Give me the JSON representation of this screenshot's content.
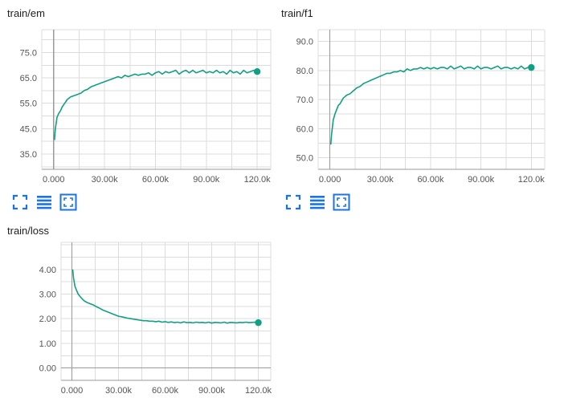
{
  "colors": {
    "series": "#12a083",
    "icon": "#1a73e8",
    "grid": "#dcdcdc"
  },
  "toolbar_icons": [
    "fit-domain-icon",
    "toggle-log-scale-icon",
    "expand-chart-icon"
  ],
  "chart_data": [
    {
      "id": "train-em",
      "type": "line",
      "title": "train/em",
      "xlabel": "",
      "ylabel": "",
      "x_ticks": [
        0,
        30000,
        60000,
        90000,
        120000
      ],
      "x_tick_labels": [
        "0.000",
        "30.00k",
        "60.00k",
        "90.00k",
        "120.0k"
      ],
      "y_ticks": [
        35,
        45,
        55,
        65,
        75
      ],
      "y_tick_labels": [
        "35.0",
        "45.0",
        "55.0",
        "65.0",
        "75.0"
      ],
      "xlim": [
        -7000,
        128000
      ],
      "ylim": [
        29,
        84
      ],
      "grid": true,
      "legend": "none",
      "series": [
        {
          "x": [
            500,
            1000,
            2000,
            3000,
            4000,
            5000,
            6000,
            7000,
            8000,
            10000,
            12000,
            14000,
            16000,
            18000,
            20000,
            22000,
            24000,
            26000,
            28000,
            30000,
            32000,
            34000,
            36000,
            38000,
            40000,
            42000,
            44000,
            46000,
            48000,
            50000,
            52000,
            54000,
            56000,
            58000,
            60000,
            62000,
            64000,
            66000,
            68000,
            70000,
            72000,
            74000,
            76000,
            78000,
            80000,
            82000,
            84000,
            86000,
            88000,
            90000,
            92000,
            94000,
            96000,
            98000,
            100000,
            102000,
            104000,
            106000,
            108000,
            110000,
            112000,
            114000,
            116000,
            118000,
            120000
          ],
          "y": [
            40.5,
            45,
            49.5,
            51,
            52,
            53.5,
            54.5,
            55.5,
            56.5,
            57.5,
            58,
            58.5,
            59,
            60,
            60.5,
            61.5,
            62,
            62.5,
            63,
            63.5,
            64,
            64.5,
            65,
            65.5,
            65,
            66,
            65.5,
            66,
            66.5,
            66,
            66.5,
            66.5,
            67,
            66,
            67,
            67.5,
            66.5,
            67.5,
            67,
            67.5,
            68,
            66.5,
            67.5,
            68,
            67,
            68,
            67,
            67.5,
            68,
            67,
            67.5,
            67,
            68,
            67,
            67.5,
            66.5,
            68,
            67,
            67.5,
            66.5,
            68,
            67,
            67.5,
            68,
            67.5
          ]
        }
      ]
    },
    {
      "id": "train-f1",
      "type": "line",
      "title": "train/f1",
      "xlabel": "",
      "ylabel": "",
      "x_ticks": [
        0,
        30000,
        60000,
        90000,
        120000
      ],
      "x_tick_labels": [
        "0.000",
        "30.00k",
        "60.00k",
        "90.00k",
        "120.0k"
      ],
      "y_ticks": [
        50,
        60,
        70,
        80,
        90
      ],
      "y_tick_labels": [
        "50.0",
        "60.0",
        "70.0",
        "80.0",
        "90.0"
      ],
      "xlim": [
        -7000,
        128000
      ],
      "ylim": [
        46,
        94
      ],
      "grid": true,
      "legend": "none",
      "series": [
        {
          "x": [
            500,
            1000,
            2000,
            3000,
            4000,
            5000,
            6000,
            7000,
            8000,
            10000,
            12000,
            14000,
            16000,
            18000,
            20000,
            22000,
            24000,
            26000,
            28000,
            30000,
            32000,
            34000,
            36000,
            38000,
            40000,
            42000,
            44000,
            46000,
            48000,
            50000,
            52000,
            54000,
            56000,
            58000,
            60000,
            62000,
            64000,
            66000,
            68000,
            70000,
            72000,
            74000,
            76000,
            78000,
            80000,
            82000,
            84000,
            86000,
            88000,
            90000,
            92000,
            94000,
            96000,
            98000,
            100000,
            102000,
            104000,
            106000,
            108000,
            110000,
            112000,
            114000,
            116000,
            118000,
            120000
          ],
          "y": [
            54.5,
            58,
            63,
            65,
            66.5,
            68,
            68.5,
            69.5,
            70.5,
            71.5,
            72,
            73,
            74,
            74.5,
            75.5,
            76,
            76.5,
            77,
            77.5,
            78,
            78.5,
            79,
            79,
            79.5,
            79.5,
            80,
            79.5,
            80.5,
            80,
            80.5,
            80.5,
            81,
            80.5,
            81,
            80.5,
            81,
            80.5,
            81,
            81,
            80.5,
            81.5,
            80.5,
            81,
            81.5,
            80.5,
            81,
            81,
            80.5,
            81.5,
            80.5,
            81,
            81,
            80.5,
            81,
            81.5,
            80.5,
            81,
            81,
            80.5,
            81,
            80.5,
            81.5,
            80.5,
            81,
            81
          ]
        }
      ]
    },
    {
      "id": "train-loss",
      "type": "line",
      "title": "train/loss",
      "xlabel": "",
      "ylabel": "",
      "x_ticks": [
        0,
        30000,
        60000,
        90000,
        120000
      ],
      "x_tick_labels": [
        "0.000",
        "30.00k",
        "60.00k",
        "90.00k",
        "120.0k"
      ],
      "y_ticks": [
        0,
        1,
        2,
        3,
        4
      ],
      "y_tick_labels": [
        "0.00",
        "1.00",
        "2.00",
        "3.00",
        "4.00"
      ],
      "xlim": [
        -7000,
        128000
      ],
      "ylim": [
        -0.5,
        5.1
      ],
      "grid": true,
      "legend": "none",
      "series": [
        {
          "x": [
            500,
            1000,
            2000,
            3000,
            4000,
            5000,
            6000,
            7000,
            8000,
            10000,
            12000,
            14000,
            16000,
            18000,
            20000,
            22000,
            24000,
            26000,
            28000,
            30000,
            32000,
            34000,
            36000,
            38000,
            40000,
            42000,
            44000,
            46000,
            48000,
            50000,
            52000,
            54000,
            56000,
            58000,
            60000,
            62000,
            64000,
            66000,
            68000,
            70000,
            72000,
            74000,
            76000,
            78000,
            80000,
            82000,
            84000,
            86000,
            88000,
            90000,
            92000,
            94000,
            96000,
            98000,
            100000,
            102000,
            104000,
            106000,
            108000,
            110000,
            112000,
            114000,
            116000,
            118000,
            120000
          ],
          "y": [
            4.0,
            3.65,
            3.3,
            3.15,
            3.0,
            2.92,
            2.85,
            2.78,
            2.72,
            2.65,
            2.6,
            2.55,
            2.48,
            2.42,
            2.35,
            2.3,
            2.25,
            2.2,
            2.15,
            2.1,
            2.08,
            2.05,
            2.02,
            2.0,
            1.98,
            1.96,
            1.94,
            1.92,
            1.92,
            1.9,
            1.9,
            1.88,
            1.9,
            1.86,
            1.88,
            1.85,
            1.87,
            1.84,
            1.86,
            1.83,
            1.87,
            1.84,
            1.85,
            1.83,
            1.86,
            1.84,
            1.85,
            1.83,
            1.86,
            1.82,
            1.85,
            1.84,
            1.83,
            1.86,
            1.82,
            1.85,
            1.84,
            1.83,
            1.85,
            1.84,
            1.86,
            1.84,
            1.85,
            1.86,
            1.84
          ]
        }
      ]
    }
  ]
}
